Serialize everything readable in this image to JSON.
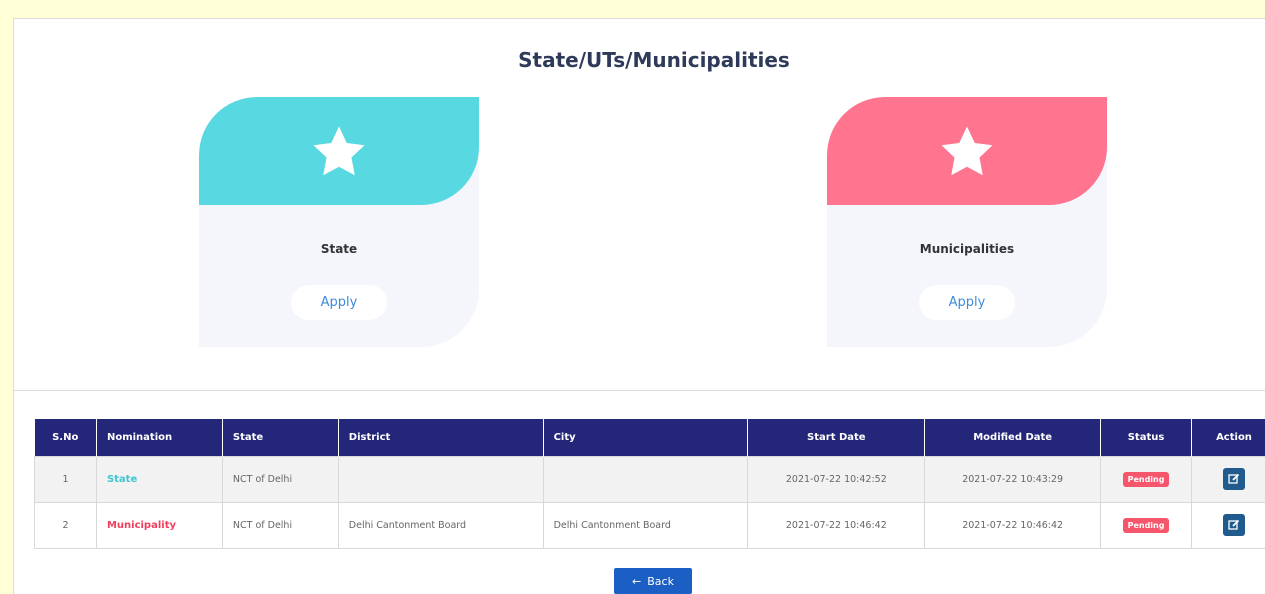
{
  "page": {
    "title": "State/UTs/Municipalities"
  },
  "cards": [
    {
      "label": "State",
      "button": "Apply",
      "color": "#58d8e0",
      "icon": "star-icon"
    },
    {
      "label": "Municipalities",
      "button": "Apply",
      "color": "#ff7590",
      "icon": "star-icon"
    }
  ],
  "table": {
    "headers": [
      "S.No",
      "Nomination",
      "State",
      "District",
      "City",
      "Start Date",
      "Modified Date",
      "Status",
      "Action"
    ],
    "rows": [
      {
        "sno": "1",
        "nomination": "State",
        "nomination_color": "#3ec6d3",
        "state": "NCT of Delhi",
        "district": "",
        "city": "",
        "start": "2021-07-22 10:42:52",
        "modified": "2021-07-22 10:43:29",
        "status": "Pending",
        "action_icon": "edit-icon"
      },
      {
        "sno": "2",
        "nomination": "Municipality",
        "nomination_color": "#f0405e",
        "state": "NCT of Delhi",
        "district": "Delhi Cantonment Board",
        "city": "Delhi Cantonment Board",
        "start": "2021-07-22 10:46:42",
        "modified": "2021-07-22 10:46:42",
        "status": "Pending",
        "action_icon": "edit-icon"
      }
    ],
    "status_color": "#f5566c"
  },
  "back_button": {
    "label": "Back",
    "icon": "arrow-left-icon"
  }
}
